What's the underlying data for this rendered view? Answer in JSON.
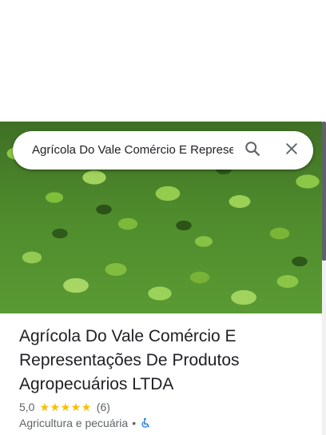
{
  "search": {
    "query": "Agrícola Do Vale Comércio E Represe",
    "search_icon": "search-icon",
    "close_icon": "close-icon"
  },
  "hero": {
    "image": "soybean-crop-photo"
  },
  "place": {
    "name": "Agrícola Do Vale Comércio E Representações De Produtos Agropecuários LTDA",
    "rating": "5,0",
    "stars": 5,
    "review_count": "(6)",
    "category": "Agricultura e pecuária",
    "separator": "•",
    "accessibility_icon": "wheelchair-accessible-icon"
  },
  "colors": {
    "star": "#fbbc04",
    "accessibility": "#1a73e8",
    "text_primary": "#202124",
    "text_secondary": "#5f6368"
  }
}
